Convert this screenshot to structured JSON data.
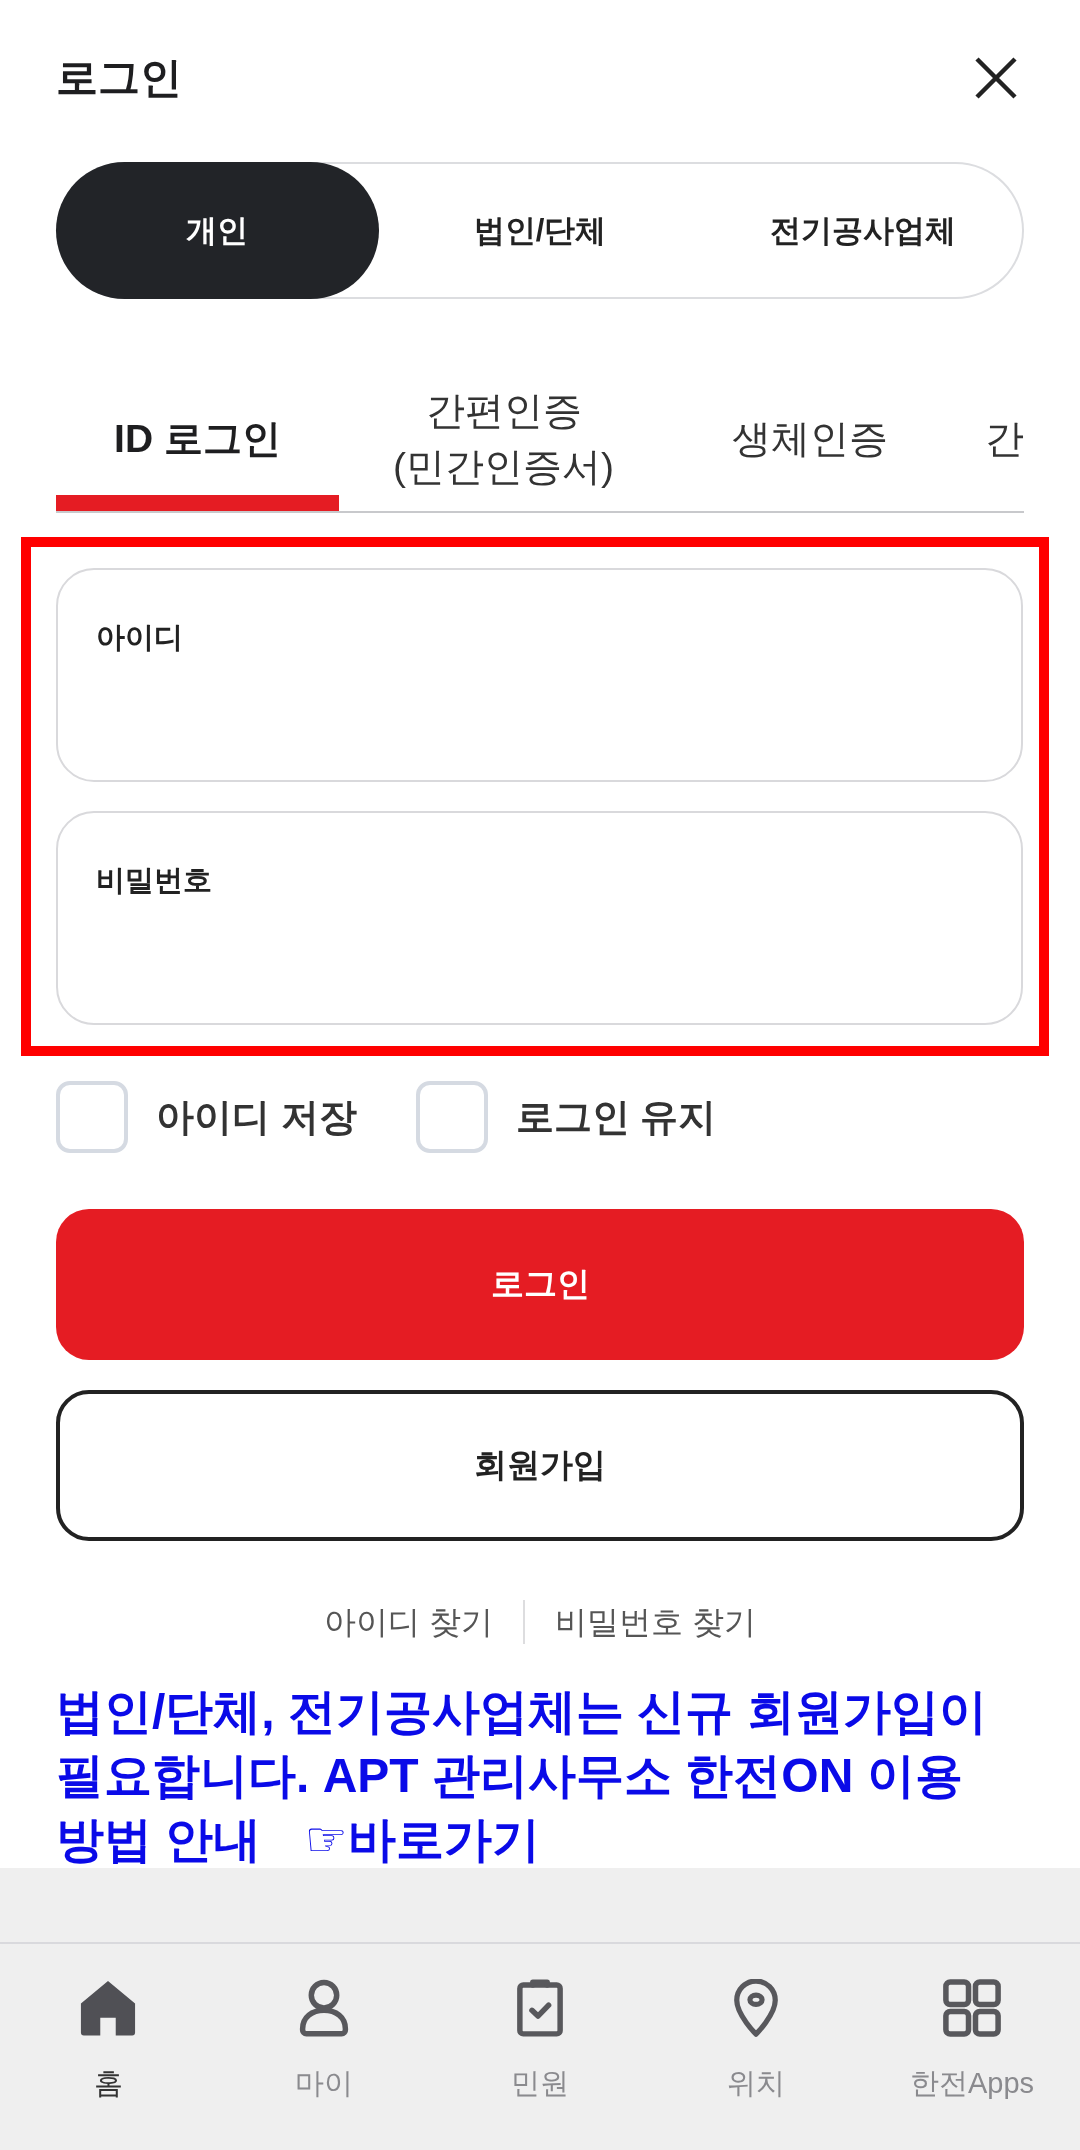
{
  "header": {
    "title": "로그인"
  },
  "user_types": [
    {
      "label": "개인",
      "selected": true
    },
    {
      "label": "법인/단체",
      "selected": false
    },
    {
      "label": "전기공사업체",
      "selected": false
    }
  ],
  "login_tabs": [
    {
      "label": "ID 로그인",
      "selected": true
    },
    {
      "label": "간편인증 (민간인증서)",
      "selected": false
    },
    {
      "label": "생체인증",
      "selected": false
    },
    {
      "label": "간",
      "selected": false
    }
  ],
  "fields": [
    {
      "label": "아이디"
    },
    {
      "label": "비밀번호"
    }
  ],
  "options": [
    {
      "label": "아이디 저장",
      "checked": false
    },
    {
      "label": "로그인 유지",
      "checked": false
    }
  ],
  "buttons": [
    {
      "kind": "primary",
      "label": "로그인"
    },
    {
      "kind": "outline",
      "label": "회원가입"
    }
  ],
  "find_links": [
    "아이디 찾기",
    "비밀번호 찾기"
  ],
  "notice": {
    "text": "법인/단체, 전기공사업체는 신규 회원가입이 필요합니다. APT 관리사무소 한전ON 이용 방법 안내",
    "link": "☞바로가기"
  },
  "bottom_nav": [
    {
      "label": "홈",
      "selected": true
    },
    {
      "label": "마이",
      "selected": false
    },
    {
      "label": "민원",
      "selected": false
    },
    {
      "label": "위치",
      "selected": false
    },
    {
      "label": "한전Apps",
      "selected": false
    }
  ]
}
